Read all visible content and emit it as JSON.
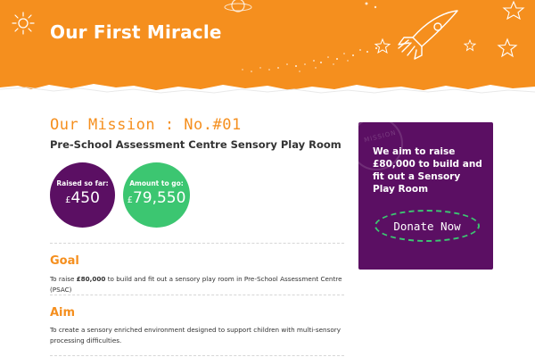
{
  "header": {
    "title": "Our First Miracle"
  },
  "mission": {
    "title": "Our Mission : No.#01",
    "subtitle": "Pre-School Assessment Centre Sensory Play Room",
    "raised_label": "Raised so far:",
    "raised_currency": "£",
    "raised_value": "450",
    "togo_label": "Amount to go:",
    "togo_currency": "£",
    "togo_value": "79,550"
  },
  "sections": {
    "goal_heading": "Goal",
    "goal_text_prefix": "To raise ",
    "goal_text_bold": "£80,000",
    "goal_text_suffix": " to build and fit out a sensory play room in Pre-School Assessment Centre (PSAC)",
    "aim_heading": "Aim",
    "aim_text": "To create a sensory enriched environment designed to support children with multi-sensory processing difficulties."
  },
  "promo": {
    "stamp_text": "MISSION",
    "text": "We aim to raise £80,000 to build and fit out a Sensory Play Room",
    "donate_label": "Donate Now"
  },
  "colors": {
    "brand_orange": "#f58f1e",
    "brand_purple": "#5b0f63",
    "accent_green": "#3cc671"
  },
  "icons": [
    "sun-icon",
    "planet-icon",
    "rocket-icon",
    "star-icon"
  ]
}
